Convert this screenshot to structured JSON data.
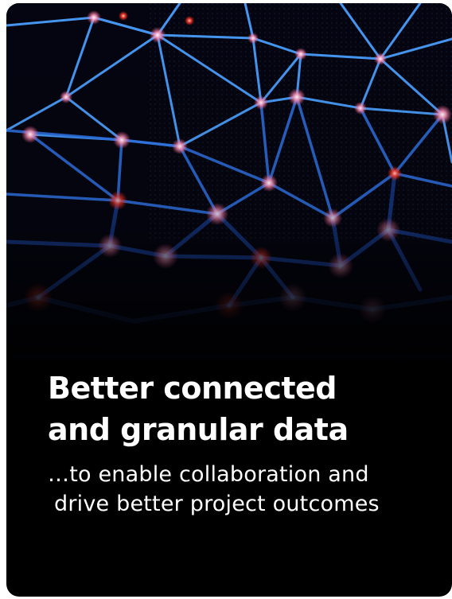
{
  "card": {
    "headline_line1": "Better connected",
    "headline_line2": "and granular data",
    "subtitle_line1": "…to enable collaboration and",
    "subtitle_line2": "drive better project outcomes"
  },
  "image": {
    "subject": "network-mesh",
    "colors": {
      "background": "#000000",
      "line": "#3a8cff",
      "node": "#ff8fb0",
      "node_hot": "#ff3a2a",
      "text": "#ffffff"
    }
  }
}
